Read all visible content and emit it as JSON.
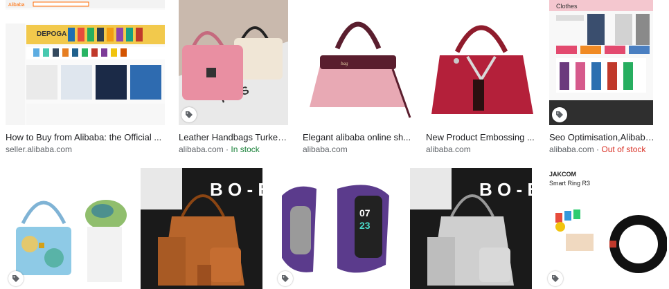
{
  "results_row1": [
    {
      "title": "How to Buy from Alibaba: the Official ...",
      "domain": "seller.alibaba.com",
      "stock": "",
      "stock_sep": ""
    },
    {
      "title": "Leather Handbags Turkey,...",
      "domain": "alibaba.com",
      "stock": "In stock",
      "stock_sep": " · "
    },
    {
      "title": "Elegant alibaba online sh...",
      "domain": "alibaba.com",
      "stock": "",
      "stock_sep": ""
    },
    {
      "title": "New Product Embossing ...",
      "domain": "alibaba.com",
      "stock": "",
      "stock_sep": ""
    },
    {
      "title": "Seo Optimisation,Alibaba ...",
      "domain": "alibaba.com",
      "stock": "Out of stock",
      "stock_sep": " · "
    }
  ],
  "thumb_text": {
    "alibaba_logo": "Alibaba",
    "depoga": "DEPOGA",
    "clothes": "Clothes",
    "boho": "B O - B",
    "jakcom": "JAKCOM",
    "smart_ring": "Smart Ring R3",
    "watch_time": "07",
    "watch_min": "23"
  },
  "colors": {
    "in_stock": "#188038",
    "out_of_stock": "#d93025",
    "title": "#202124",
    "source": "#5f6368"
  },
  "icons": {
    "tag": "tag-icon"
  }
}
